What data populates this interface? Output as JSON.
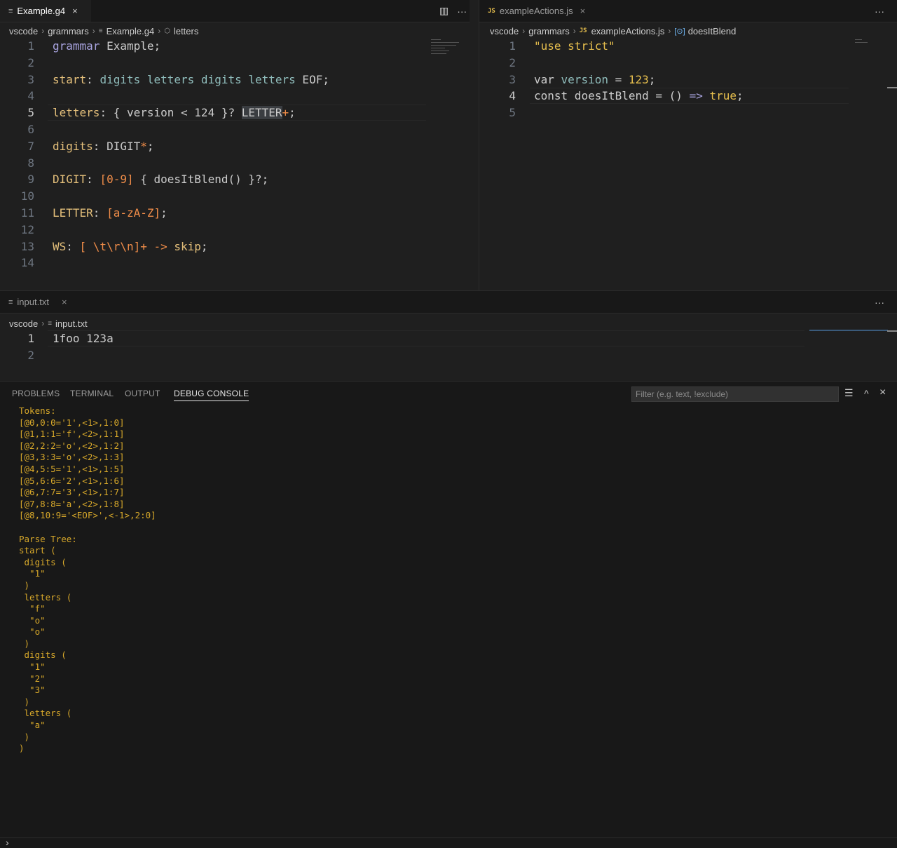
{
  "left_editor": {
    "tab": {
      "icon": "≡",
      "label": "Example.g4",
      "close": "×"
    },
    "actions": {
      "split": "▥",
      "more": "···"
    },
    "breadcrumb": [
      "vscode",
      "grammars",
      "Example.g4",
      "letters"
    ],
    "line_numbers": [
      "1",
      "2",
      "3",
      "4",
      "5",
      "6",
      "7",
      "8",
      "9",
      "10",
      "11",
      "12",
      "13",
      "14"
    ],
    "lines": {
      "l1": {
        "a": "grammar",
        "b": " Example;"
      },
      "l3": {
        "a": "start",
        "b": ": ",
        "c": "digits letters digits letters",
        "d": " EOF;"
      },
      "l5": {
        "a": "letters",
        "b": ": { version < 124 }? ",
        "c": "LETTER",
        "d": "+",
        "e": ";"
      },
      "l7": {
        "a": "digits",
        "b": ": DIGIT",
        "c": "*",
        "d": ";"
      },
      "l9": {
        "a": "DIGIT",
        "b": ": ",
        "c": "[0-9]",
        "d": " { doesItBlend() }?;"
      },
      "l11": {
        "a": "LETTER",
        "b": ": ",
        "c": "[a-zA-Z]",
        "d": ";"
      },
      "l13": {
        "a": "WS",
        "b": ": ",
        "c": "[ \\t\\r\\n]+",
        "d": " -> ",
        "e": "skip",
        "f": ";"
      }
    }
  },
  "right_editor": {
    "tab": {
      "icon": "JS",
      "label": "exampleActions.js",
      "close": "×"
    },
    "actions": {
      "more": "···"
    },
    "breadcrumb": [
      "vscode",
      "grammars",
      "exampleActions.js",
      "doesItBlend"
    ],
    "line_numbers": [
      "1",
      "2",
      "3",
      "4",
      "5"
    ],
    "lines": {
      "l1": {
        "a": "\"use strict\""
      },
      "l3": {
        "a": "var",
        "b": " version",
        "c": " = ",
        "d": "123",
        "e": ";"
      },
      "l4": {
        "a": "const",
        "b": " doesItBlend = () ",
        "c": "=>",
        "d": " ",
        "e": "true",
        "f": ";"
      }
    }
  },
  "bottom_editor": {
    "tab": {
      "icon": "≡",
      "label": "input.txt",
      "close": "×"
    },
    "actions": {
      "more": "···"
    },
    "breadcrumb": [
      "vscode",
      "input.txt"
    ],
    "line_numbers": [
      "1",
      "2"
    ],
    "lines": {
      "l1": "1foo 123a"
    }
  },
  "panel": {
    "tabs": [
      "PROBLEMS",
      "TERMINAL",
      "OUTPUT",
      "DEBUG CONSOLE"
    ],
    "active_tab": "DEBUG CONSOLE",
    "filter_placeholder": "Filter (e.g. text, !exclude)",
    "console_lines": [
      "Tokens:",
      "[@0,0:0='1',<1>,1:0]",
      "[@1,1:1='f',<2>,1:1]",
      "[@2,2:2='o',<2>,1:2]",
      "[@3,3:3='o',<2>,1:3]",
      "[@4,5:5='1',<1>,1:5]",
      "[@5,6:6='2',<1>,1:6]",
      "[@6,7:7='3',<1>,1:7]",
      "[@7,8:8='a',<2>,1:8]",
      "[@8,10:9='<EOF>',<-1>,2:0]",
      "",
      "Parse Tree:",
      "start (",
      " digits (",
      "  \"1\"",
      " )",
      " letters (",
      "  \"f\"",
      "  \"o\"",
      "  \"o\"",
      " )",
      " digits (",
      "  \"1\"",
      "  \"2\"",
      "  \"3\"",
      " )",
      " letters (",
      "  \"a\"",
      " )",
      ")"
    ],
    "icons": {
      "clear": "☰",
      "maximize": "^",
      "close": "×"
    },
    "input_prompt": "›"
  },
  "colors": {
    "console": "#d7a82a",
    "keyword": "#a9a4e0",
    "rule": "#8fbcbb",
    "token": "#e5c07b",
    "orange": "#f08d49"
  }
}
